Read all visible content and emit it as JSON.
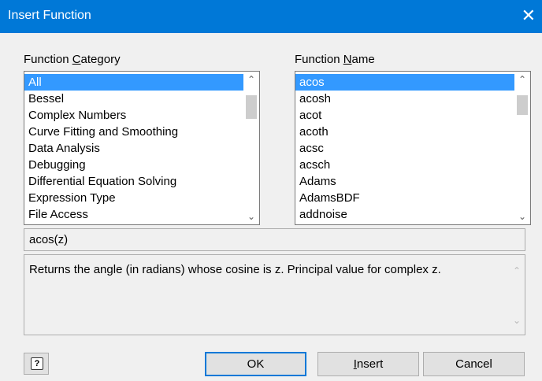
{
  "window": {
    "title": "Insert Function",
    "close_glyph": "✕"
  },
  "category": {
    "label_pre": "Function ",
    "label_accel": "C",
    "label_post": "ategory",
    "items": [
      "All",
      "Bessel",
      "Complex Numbers",
      "Curve Fitting and Smoothing",
      "Data Analysis",
      "Debugging",
      "Differential Equation Solving",
      "Expression Type",
      "File Access"
    ],
    "selected": "All"
  },
  "name": {
    "label_pre": "Function ",
    "label_accel": "N",
    "label_post": "ame",
    "items": [
      "acos",
      "acosh",
      "acot",
      "acoth",
      "acsc",
      "acsch",
      "Adams",
      "AdamsBDF",
      "addnoise"
    ],
    "selected": "acos"
  },
  "syntax": "acos(z)",
  "description": "Returns the angle (in radians) whose cosine is z. Principal value for complex z.",
  "buttons": {
    "help_glyph": "?",
    "ok": "OK",
    "insert_accel": "I",
    "insert_rest": "nsert",
    "cancel": "Cancel"
  },
  "scroll": {
    "up": "⌃",
    "down": "⌄"
  }
}
